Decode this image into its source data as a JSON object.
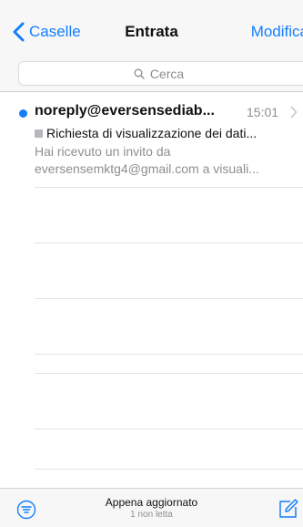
{
  "nav": {
    "back_label": "Caselle",
    "title": "Entrata",
    "edit_label": "Modifica"
  },
  "search": {
    "placeholder": "Cerca"
  },
  "messages": [
    {
      "sender": "noreply@eversensediab...",
      "time": "15:01",
      "subject": "Richiesta di visualizzazione dei dati...",
      "preview_line1": "Hai ricevuto un invito da",
      "preview_line2": "eversensemktg4@gmail.com a visuali...",
      "unread": true
    }
  ],
  "toolbar": {
    "status_main": "Appena aggiornato",
    "status_sub": "1 non letta"
  },
  "colors": {
    "accent": "#147efb",
    "secondary_text": "#8e8e93",
    "bar_background": "#f7f7f7"
  },
  "icons": {
    "back": "chevron-left-icon",
    "search": "search-icon",
    "disclosure": "chevron-right-icon",
    "filter": "filter-icon",
    "compose": "compose-icon"
  }
}
